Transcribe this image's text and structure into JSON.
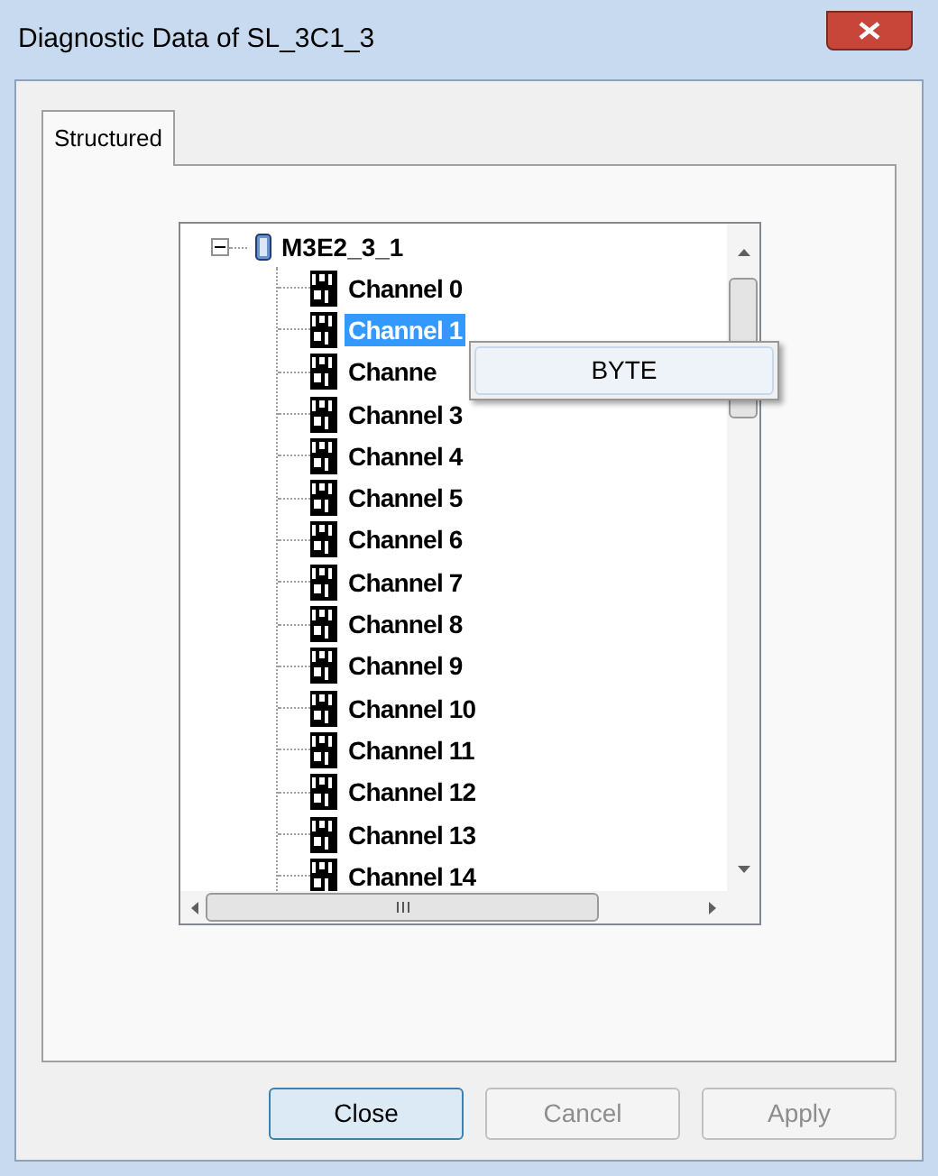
{
  "window": {
    "title": "Diagnostic Data of SL_3C1_3"
  },
  "tabs": [
    {
      "label": "Structured",
      "selected": true
    }
  ],
  "tree": {
    "label": "M3E2_3_1",
    "expanded": true,
    "children": [
      {
        "label": "Channel 0",
        "selected": false
      },
      {
        "label": "Channel 1",
        "selected": true
      },
      {
        "label": "Channe",
        "selected": false
      },
      {
        "label": "Channel 3",
        "selected": false
      },
      {
        "label": "Channel 4",
        "selected": false
      },
      {
        "label": "Channel 5",
        "selected": false
      },
      {
        "label": "Channel 6",
        "selected": false
      },
      {
        "label": "Channel 7",
        "selected": false
      },
      {
        "label": "Channel 8",
        "selected": false
      },
      {
        "label": "Channel 9",
        "selected": false
      },
      {
        "label": "Channel 10",
        "selected": false
      },
      {
        "label": "Channel 11",
        "selected": false
      },
      {
        "label": "Channel 12",
        "selected": false
      },
      {
        "label": "Channel 13",
        "selected": false
      },
      {
        "label": "Channel 14",
        "selected": false
      }
    ]
  },
  "context_menu": {
    "items": [
      "BYTE"
    ]
  },
  "buttons": [
    {
      "label": "Close",
      "disabled": false
    },
    {
      "label": "Cancel",
      "disabled": true
    },
    {
      "label": "Apply",
      "disabled": true
    }
  ]
}
